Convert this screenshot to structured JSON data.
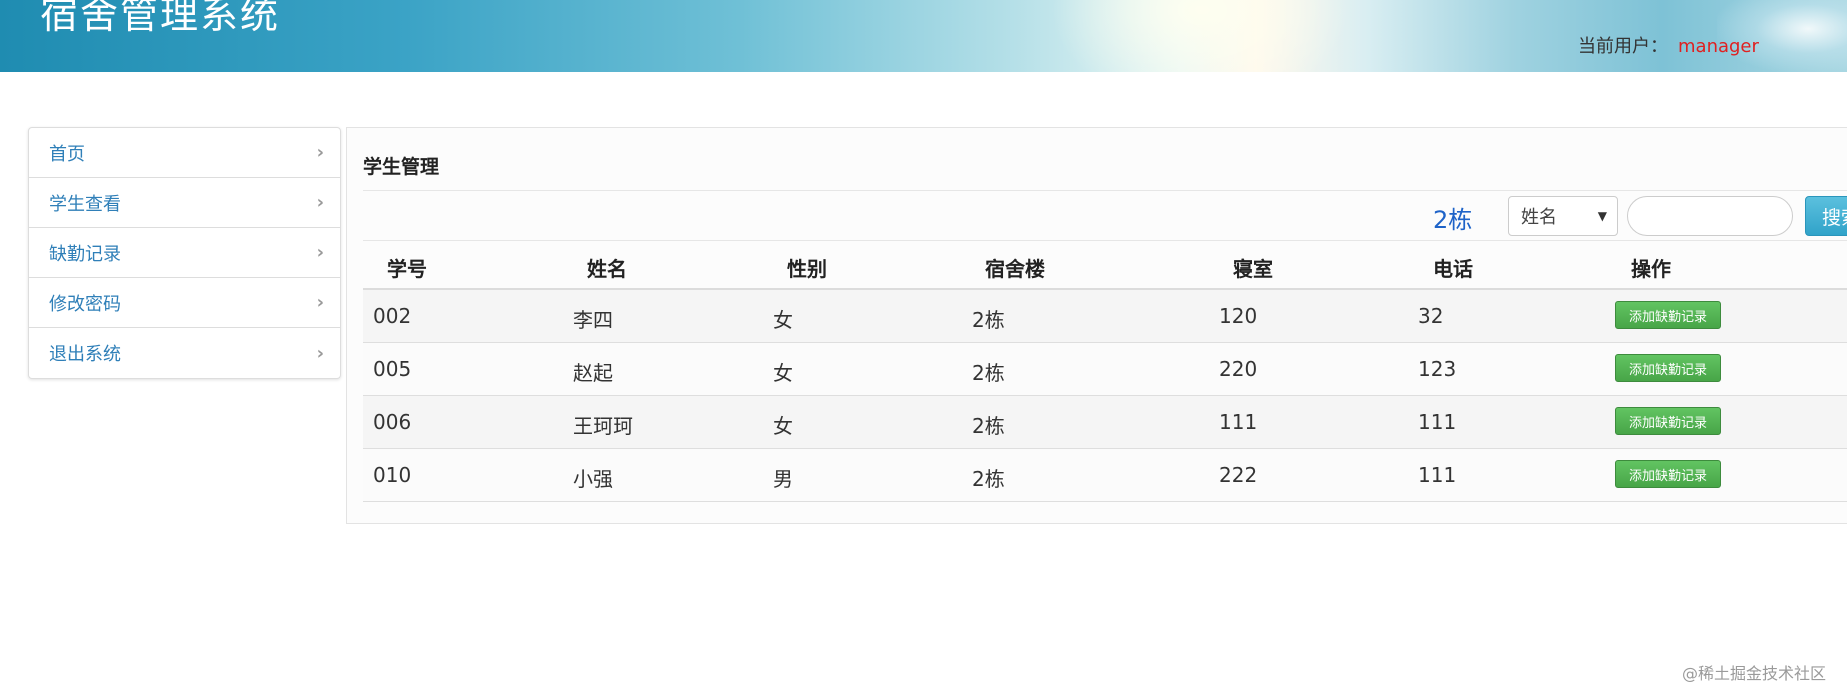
{
  "header": {
    "title": "宿舍管理系统",
    "user_label": "当前用户：",
    "username": "manager"
  },
  "sidebar": {
    "items": [
      {
        "label": "首页"
      },
      {
        "label": "学生查看"
      },
      {
        "label": "缺勤记录"
      },
      {
        "label": "修改密码"
      },
      {
        "label": "退出系统"
      }
    ]
  },
  "panel": {
    "title": "学生管理",
    "building": "2栋",
    "search_field": "姓名",
    "search_value": "",
    "search_button": "搜索"
  },
  "table": {
    "headers": [
      "学号",
      "姓名",
      "性别",
      "宿舍楼",
      "寝室",
      "电话",
      "操作"
    ],
    "rows": [
      {
        "id": "002",
        "name": "李四",
        "gender": "女",
        "building": "2栋",
        "room": "120",
        "phone": "32",
        "action": "添加缺勤记录"
      },
      {
        "id": "005",
        "name": "赵起",
        "gender": "女",
        "building": "2栋",
        "room": "220",
        "phone": "123",
        "action": "添加缺勤记录"
      },
      {
        "id": "006",
        "name": "王珂珂",
        "gender": "女",
        "building": "2栋",
        "room": "111",
        "phone": "111",
        "action": "添加缺勤记录"
      },
      {
        "id": "010",
        "name": "小强",
        "gender": "男",
        "building": "2栋",
        "room": "222",
        "phone": "111",
        "action": "添加缺勤记录"
      }
    ]
  },
  "watermark": "@稀土掘金技术社区",
  "icons": {
    "chevron": "chevron-right-icon",
    "dropdown": "caret-down-icon"
  },
  "colors": {
    "link": "#2f7fb8",
    "username": "#e02020",
    "building": "#1e63c8",
    "primary_button": "#31a3c9",
    "success_button": "#48a548"
  }
}
